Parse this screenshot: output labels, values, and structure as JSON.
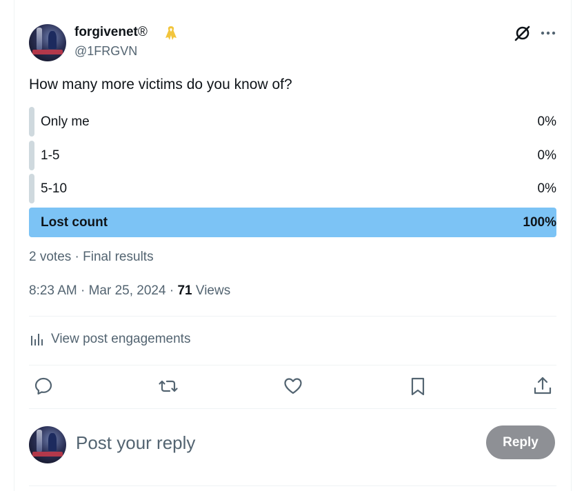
{
  "author": {
    "display_name": "forgivenet",
    "registered_mark": "®",
    "handle": "@1FRGVN",
    "ribbon_color": "#f2c53d"
  },
  "tweet": {
    "question": "How many more victims do you know of?"
  },
  "poll": {
    "options": [
      {
        "label": "Only me",
        "percent_text": "0%",
        "percent": 0
      },
      {
        "label": "1-5",
        "percent_text": "0%",
        "percent": 0
      },
      {
        "label": "5-10",
        "percent_text": "0%",
        "percent": 0
      },
      {
        "label": "Lost count",
        "percent_text": "100%",
        "percent": 100,
        "winner": true
      }
    ],
    "meta": "2 votes · Final results",
    "bar_color": "#cfd9de",
    "winner_color": "#7cc3f5"
  },
  "timestamp": {
    "text": "8:23 AM · Mar 25, 2024 · ",
    "views_count": "71",
    "views_label": " Views"
  },
  "engagements": {
    "label": "View post engagements",
    "icon": "bar-chart-icon"
  },
  "actions": {
    "icons": [
      "reply-icon",
      "retweet-icon",
      "like-icon",
      "bookmark-icon",
      "share-icon"
    ]
  },
  "header_icons": [
    "grok-icon",
    "more-icon"
  ],
  "reply": {
    "placeholder": "Post your reply",
    "button_label": "Reply",
    "button_color": "#8e9095"
  }
}
